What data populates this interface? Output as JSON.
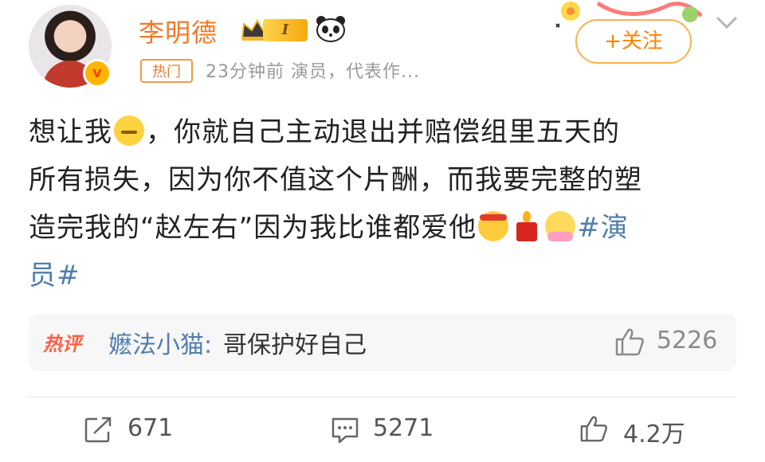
{
  "header": {
    "username": "李明德",
    "level_badge": "I",
    "hot_tag": "热门",
    "meta": "23分钟前  演员，代表作...",
    "follow_label": "+关注",
    "verified_badge": "v"
  },
  "post": {
    "line1_a": "想让我",
    "line1_b": "，你就自己主动退出并赔偿组里五天的",
    "line2": "所有损失，因为你不值这个片酬，而我要完整的塑",
    "line3": "造完我的“赵左右”因为我比谁都爱他",
    "hashtag_a": "#演",
    "hashtag_b": "员#",
    "emojis": [
      "zipper-mouth-emoji",
      "fighting-emoji",
      "candle-emoji",
      "pray-emoji"
    ]
  },
  "hot_comment": {
    "label": "热评",
    "user": "嬷法小猫:",
    "text": "哥保护好自己",
    "likes": "5226"
  },
  "actions": {
    "repost": "671",
    "comment": "5271",
    "like": "4.2万"
  },
  "colors": {
    "accent": "#ff8200",
    "username": "#ee7a2a",
    "link": "#507daf",
    "hot": "#ff5f45"
  }
}
